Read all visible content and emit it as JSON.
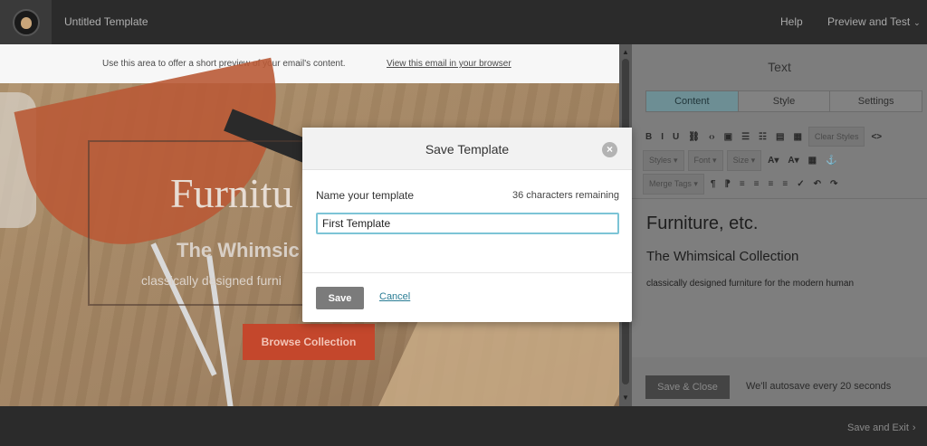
{
  "topbar": {
    "title": "Untitled Template",
    "help": "Help",
    "preview": "Preview and Test",
    "preview_chevron": "⌄"
  },
  "canvas": {
    "preheader_text": "Use this area to offer a short preview of your email's content.",
    "preheader_link": "View this email in your browser",
    "hero_title": "Furnitu",
    "hero_subtitle": "The Whimsic",
    "hero_description": "classically designed furni",
    "browse_button": "Browse Collection"
  },
  "panel": {
    "title": "Text",
    "tabs": [
      {
        "label": "Content",
        "active": true
      },
      {
        "label": "Style",
        "active": false
      },
      {
        "label": "Settings",
        "active": false
      }
    ],
    "toolbar_row1": [
      "B",
      "I",
      "U",
      "⛓",
      "‹›",
      "▣",
      "☰",
      "☷",
      "▤",
      "▦"
    ],
    "clear_styles": "Clear Styles",
    "code_icon": "<>",
    "styles_dropdown": "Styles ▾",
    "font_dropdown": "Font ▾",
    "size_dropdown": "Size ▾",
    "merge_tags": "Merge Tags ▾",
    "editor_heading": "Furniture, etc.",
    "editor_subheading": "The Whimsical Collection",
    "editor_text": "classically designed furniture for the modern human",
    "save_close": "Save & Close",
    "autosave": "We'll autosave every 20 seconds"
  },
  "bottombar": {
    "save_exit": "Save and Exit",
    "chevron": "›"
  },
  "modal": {
    "title": "Save Template",
    "close_symbol": "×",
    "field_label": "Name your template",
    "char_remaining": "36 characters remaining",
    "input_value": "First Template",
    "save_button": "Save",
    "cancel_link": "Cancel"
  },
  "colors": {
    "accent": "#7cc4d6",
    "link": "#2a7d95",
    "cta": "#c4472c"
  }
}
